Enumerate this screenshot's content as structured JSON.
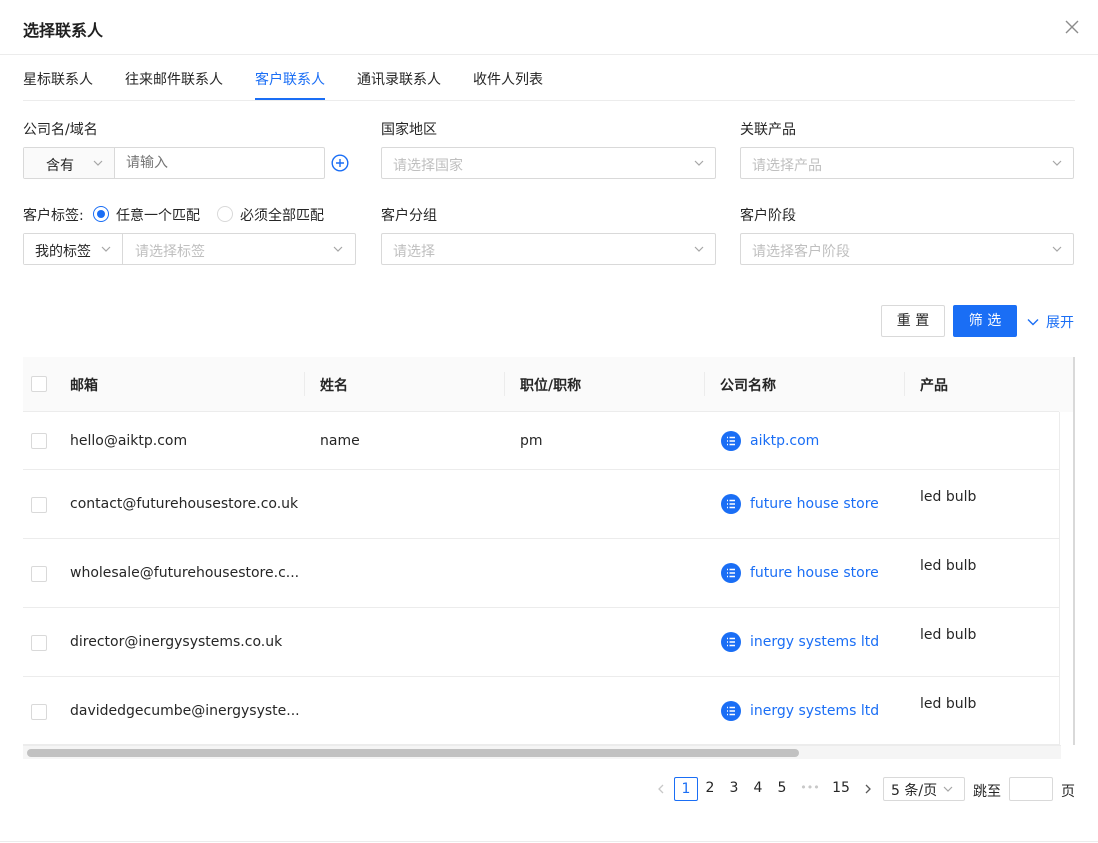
{
  "dialog": {
    "title": "选择联系人"
  },
  "tabs": [
    {
      "label": "星标联系人"
    },
    {
      "label": "往来邮件联系人"
    },
    {
      "label": "客户联系人"
    },
    {
      "label": "通讯录联系人"
    },
    {
      "label": "收件人列表"
    }
  ],
  "filters": {
    "company": {
      "label": "公司名/域名",
      "operator": "含有",
      "placeholder": "请输入"
    },
    "country": {
      "label": "国家地区",
      "placeholder": "请选择国家"
    },
    "product": {
      "label": "关联产品",
      "placeholder": "请选择产品"
    },
    "tags": {
      "label": "客户标签:",
      "option_any": "任意一个匹配",
      "option_all": "必须全部匹配",
      "scope": "我的标签",
      "placeholder": "请选择标签"
    },
    "group": {
      "label": "客户分组",
      "placeholder": "请选择"
    },
    "stage": {
      "label": "客户阶段",
      "placeholder": "请选择客户阶段"
    }
  },
  "actions": {
    "reset": "重 置",
    "filter": "筛 选",
    "expand": "展开"
  },
  "table": {
    "columns": [
      "邮箱",
      "姓名",
      "职位/职称",
      "公司名称",
      "产品"
    ],
    "rows": [
      {
        "email": "hello@aiktp.com",
        "name": "name",
        "title": "pm",
        "company": "aiktp.com",
        "product": ""
      },
      {
        "email": "contact@futurehousestore.co.uk",
        "name": "",
        "title": "",
        "company": "future house store",
        "product": "led bulb"
      },
      {
        "email": "wholesale@futurehousestore.c...",
        "name": "",
        "title": "",
        "company": "future house store",
        "product": "led bulb"
      },
      {
        "email": "director@inergysystems.co.uk",
        "name": "",
        "title": "",
        "company": "inergy systems ltd",
        "product": "led bulb"
      },
      {
        "email": "davidedgecumbe@inergysyste...",
        "name": "",
        "title": "",
        "company": "inergy systems ltd",
        "product": "led bulb"
      }
    ]
  },
  "pagination": {
    "pages": [
      "1",
      "2",
      "3",
      "4",
      "5"
    ],
    "ellipsis": "•••",
    "last": "15",
    "current": "1",
    "page_size": "5 条/页",
    "jump_label": "跳至",
    "page_suffix": "页"
  },
  "colors": {
    "accent": "#1a6ef5",
    "border": "#d9d9d9",
    "placeholder": "#bfbfbf"
  }
}
